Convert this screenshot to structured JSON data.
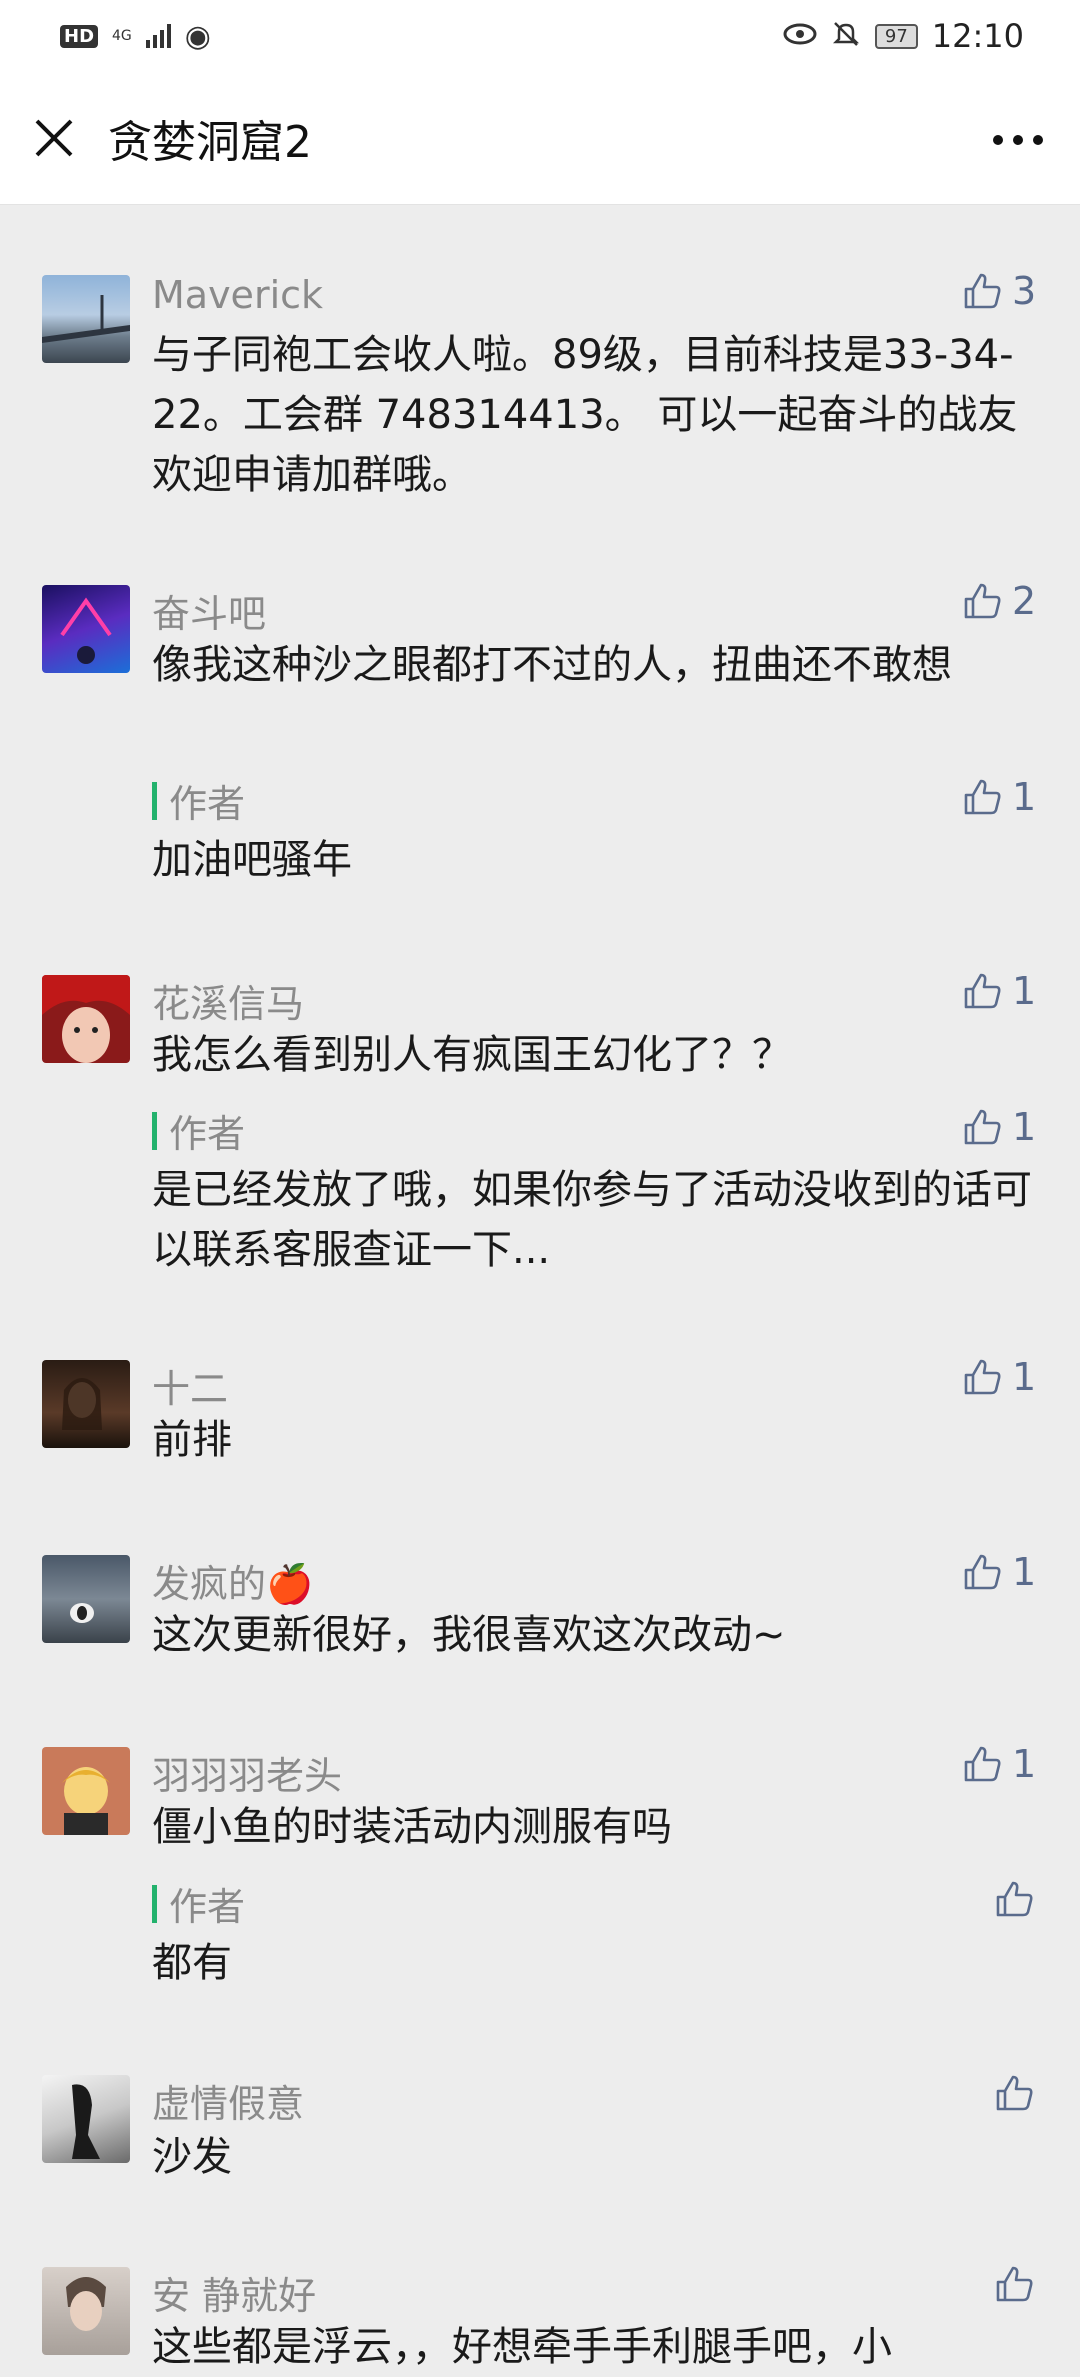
{
  "status_bar": {
    "hd": "HD",
    "network": "4G",
    "battery": "97",
    "time": "12:10"
  },
  "header": {
    "title": "贪婪洞窟2"
  },
  "comments": [
    {
      "name": "Maverick",
      "likes": "3",
      "text": "与子同袍工会收人啦。89级，目前科技是33-34-22。工会群 748314413。 可以一起奋斗的战友欢迎申请加群哦。"
    },
    {
      "name": "奋斗吧",
      "likes": "2",
      "text": "像我这种沙之眼都打不过的人，扭曲还不敢想",
      "reply": {
        "label": "作者",
        "likes": "1",
        "text": "加油吧骚年"
      }
    },
    {
      "name": "花溪信马",
      "likes": "1",
      "text": "我怎么看到别人有疯国王幻化了？？",
      "reply": {
        "label": "作者",
        "likes": "1",
        "text": "是已经发放了哦，如果你参与了活动没收到的话可以联系客服查证一下..."
      }
    },
    {
      "name": "十二",
      "likes": "1",
      "text": "前排"
    },
    {
      "name": "发疯的🍎",
      "likes": "1",
      "text": "这次更新很好，我很喜欢这次改动~"
    },
    {
      "name": "羽羽羽老头",
      "likes": "1",
      "text": "僵小鱼的时装活动内测服有吗",
      "reply": {
        "label": "作者",
        "likes": "",
        "text": "都有"
      }
    },
    {
      "name": "虚情假意",
      "likes": "",
      "text": "沙发"
    },
    {
      "name": "安 静就好",
      "likes": "",
      "text": "这些都是浮云，，好想牵手手利腿手吧，小"
    }
  ]
}
